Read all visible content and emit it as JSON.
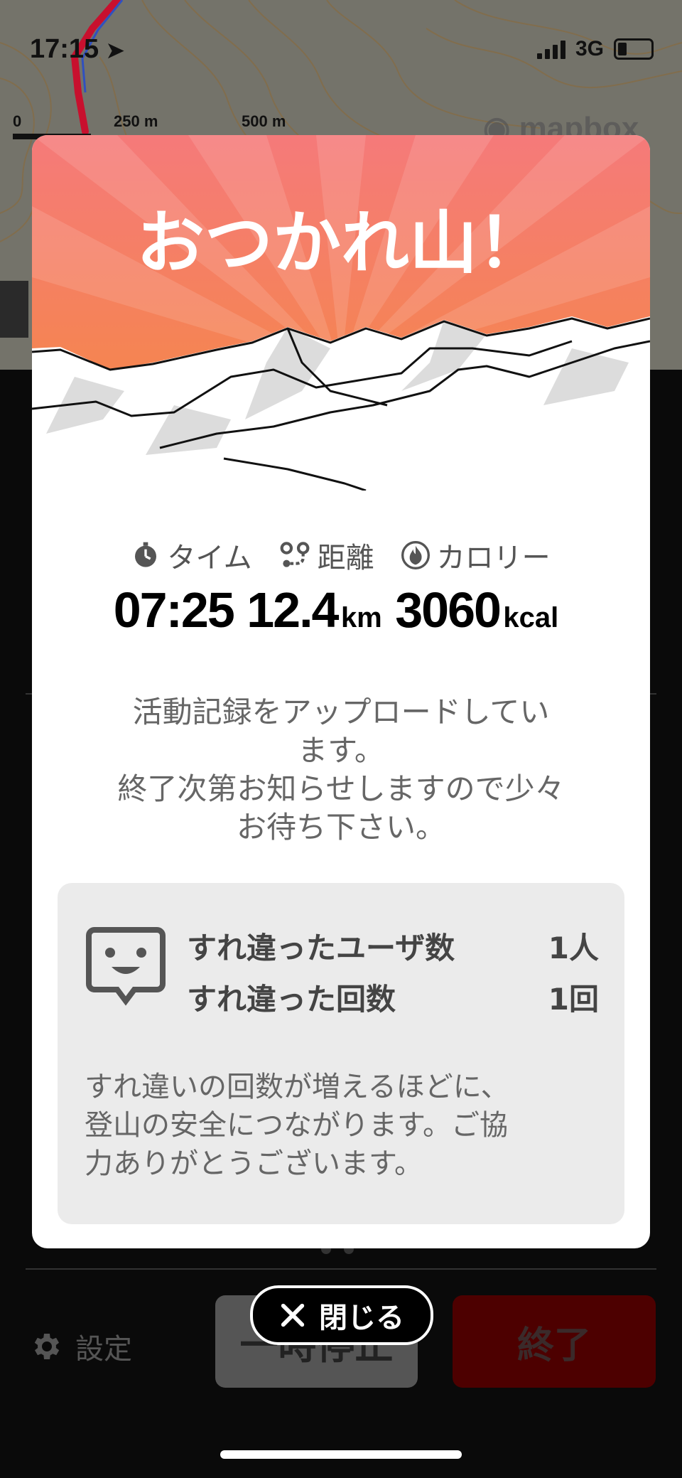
{
  "status_bar": {
    "time": "17:15",
    "network": "3G"
  },
  "map": {
    "scale_labels": [
      "0",
      "250 m",
      "500 m"
    ],
    "attribution": "mapbox"
  },
  "modal": {
    "title": "おつかれ山！",
    "stats": {
      "time_label": "タイム",
      "distance_label": "距離",
      "calorie_label": "カロリー",
      "time_value": "07:25",
      "distance_value": "12.4",
      "distance_unit": "km",
      "calorie_value": "3060",
      "calorie_unit": "kcal"
    },
    "message_lines": [
      "活動記録をアップロードしてい",
      "ます。",
      "終了次第お知らせしますので少々",
      "お待ち下さい。"
    ],
    "encounter": {
      "users_label": "すれ違ったユーザ数",
      "users_value": "1人",
      "count_label": "すれ違った回数",
      "count_value": "1回",
      "note_lines": [
        "すれ違いの回数が増えるほどに、",
        "登山の安全につながります。ご協",
        "力ありがとうございます。"
      ]
    },
    "close_label": "閉じる"
  },
  "background_screen": {
    "settings_label": "設定",
    "pause_label": "一時停止",
    "end_label": "終了"
  },
  "colors": {
    "hero_top": "#f57a7a",
    "hero_bottom": "#f58a3c",
    "end_button": "#4d0000"
  }
}
